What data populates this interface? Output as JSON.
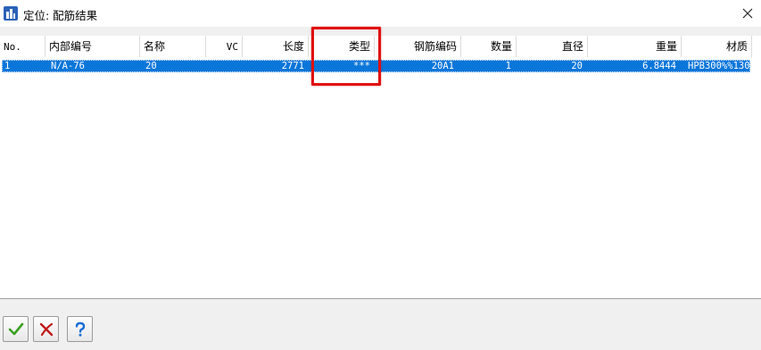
{
  "window": {
    "title": "定位: 配筋结果",
    "icon": "app-building-icon",
    "close_icon": "close-icon"
  },
  "table": {
    "columns": [
      "No.",
      "内部编号",
      "名称",
      "VC",
      "长度",
      "类型",
      "钢筋编码",
      "数量",
      "直径",
      "重量",
      "材质"
    ],
    "rows": [
      [
        "1",
        "N/A-76",
        "20",
        "",
        "2771",
        "***",
        "20A1",
        "1",
        "20",
        "6.8444",
        "HPB300%%130"
      ]
    ],
    "selected_row": 0
  },
  "highlight": {
    "color": "#e01010",
    "target": "类型"
  },
  "buttons": {
    "ok": "check-icon",
    "cancel": "cancel-x-icon",
    "help": "help-question-icon"
  },
  "colors": {
    "selection": "#0a76d9",
    "highlight": "#e01010",
    "help": "#1a6fd6",
    "ok": "#3aa020"
  }
}
